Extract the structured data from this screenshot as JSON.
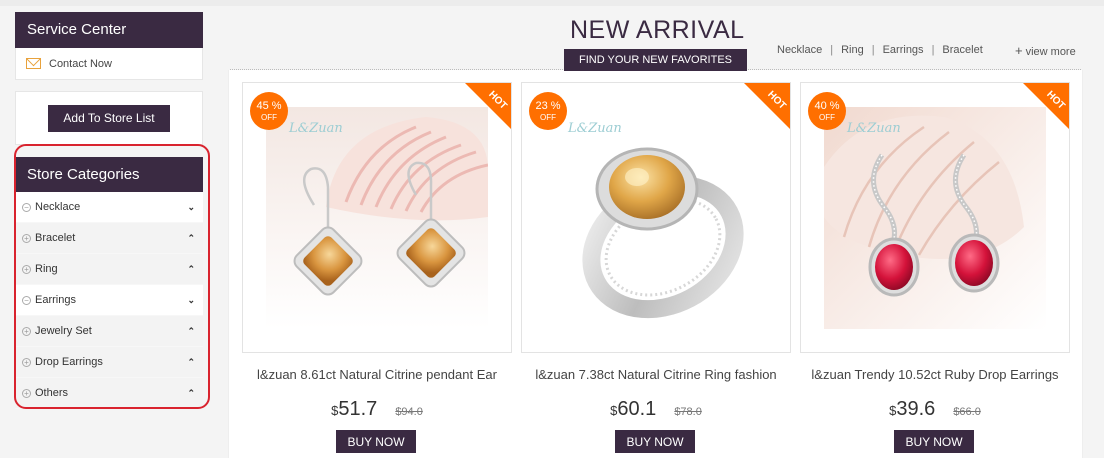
{
  "sidebar": {
    "service_center": {
      "title": "Service Center",
      "contact_label": "Contact Now"
    },
    "add_store_label": "Add To Store List",
    "categories_title": "Store Categories",
    "categories": [
      {
        "label": "Necklace",
        "toggle": "−",
        "chevron": "⌄"
      },
      {
        "label": "Bracelet",
        "toggle": "+",
        "chevron": "⌃"
      },
      {
        "label": "Ring",
        "toggle": "+",
        "chevron": "⌃"
      },
      {
        "label": "Earrings",
        "toggle": "−",
        "chevron": "⌄"
      },
      {
        "label": "Jewelry Set",
        "toggle": "+",
        "chevron": "⌃"
      },
      {
        "label": "Drop Earrings",
        "toggle": "+",
        "chevron": "⌃"
      },
      {
        "label": "Others",
        "toggle": "+",
        "chevron": "⌃"
      }
    ]
  },
  "main": {
    "title": "NEW ARRIVAL",
    "subtitle": "FIND YOUR NEW FAVORITES",
    "quick_links": [
      "Necklace",
      "Ring",
      "Earrings",
      "Bracelet"
    ],
    "separator": "|",
    "view_more": "view more",
    "view_more_icon": "+"
  },
  "products": [
    {
      "badge_percent": "45 %",
      "badge_off": "OFF",
      "hot": "HOT",
      "brand": "L&Zuan",
      "name": "l&zuan 8.61ct Natural Citrine pendant Ear",
      "currency": "$",
      "price": "51.7",
      "old_price": "$94.0",
      "buy_label": "BUY NOW"
    },
    {
      "badge_percent": "23 %",
      "badge_off": "OFF",
      "hot": "HOT",
      "brand": "L&Zuan",
      "name": "l&zuan 7.38ct Natural Citrine Ring fashion",
      "currency": "$",
      "price": "60.1",
      "old_price": "$78.0",
      "buy_label": "BUY NOW"
    },
    {
      "badge_percent": "40 %",
      "badge_off": "OFF",
      "hot": "HOT",
      "brand": "L&Zuan",
      "name": "l&zuan Trendy 10.52ct Ruby Drop Earrings",
      "currency": "$",
      "price": "39.6",
      "old_price": "$66.0",
      "buy_label": "BUY NOW"
    }
  ],
  "colors": {
    "brand_dark": "#3a2a42",
    "accent_orange": "#ff6f00",
    "highlight_red": "#d9232e"
  }
}
